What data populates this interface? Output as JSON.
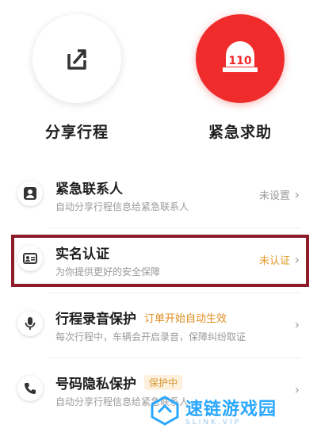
{
  "actions": [
    {
      "label": "分享行程",
      "icon": "share-icon"
    },
    {
      "label": "紧急求助",
      "icon": "sos-110-icon",
      "icon_text": "110",
      "color": "#ef2b2b"
    }
  ],
  "list": {
    "items": [
      {
        "title": "紧急联系人",
        "subtitle": "自动分享行程信息给紧急联系人",
        "status": "未设置",
        "icon": "contact-icon"
      },
      {
        "title": "实名认证",
        "subtitle": "为你提供更好的安全保障",
        "status": "未认证",
        "icon": "id-card-icon",
        "highlighted": true
      },
      {
        "title": "行程录音保护",
        "tag": "订单开始自动生效",
        "subtitle": "每次行程中，车辆会开启录音，保障纠纷取证",
        "status": "",
        "icon": "microphone-icon"
      },
      {
        "title": "号码隐私保护",
        "tag": "保护中",
        "subtitle": "自动分享行程信息给紧急联系人",
        "status": "",
        "icon": "phone-icon"
      }
    ]
  },
  "watermark": {
    "title": "速链游戏园",
    "subtitle": "SLINK.VIP"
  },
  "colors": {
    "accent_red": "#ef2b2b",
    "warning": "#e39a2a",
    "highlight_border": "#8e1d2a",
    "watermark_blue": "#2aa7ff"
  }
}
